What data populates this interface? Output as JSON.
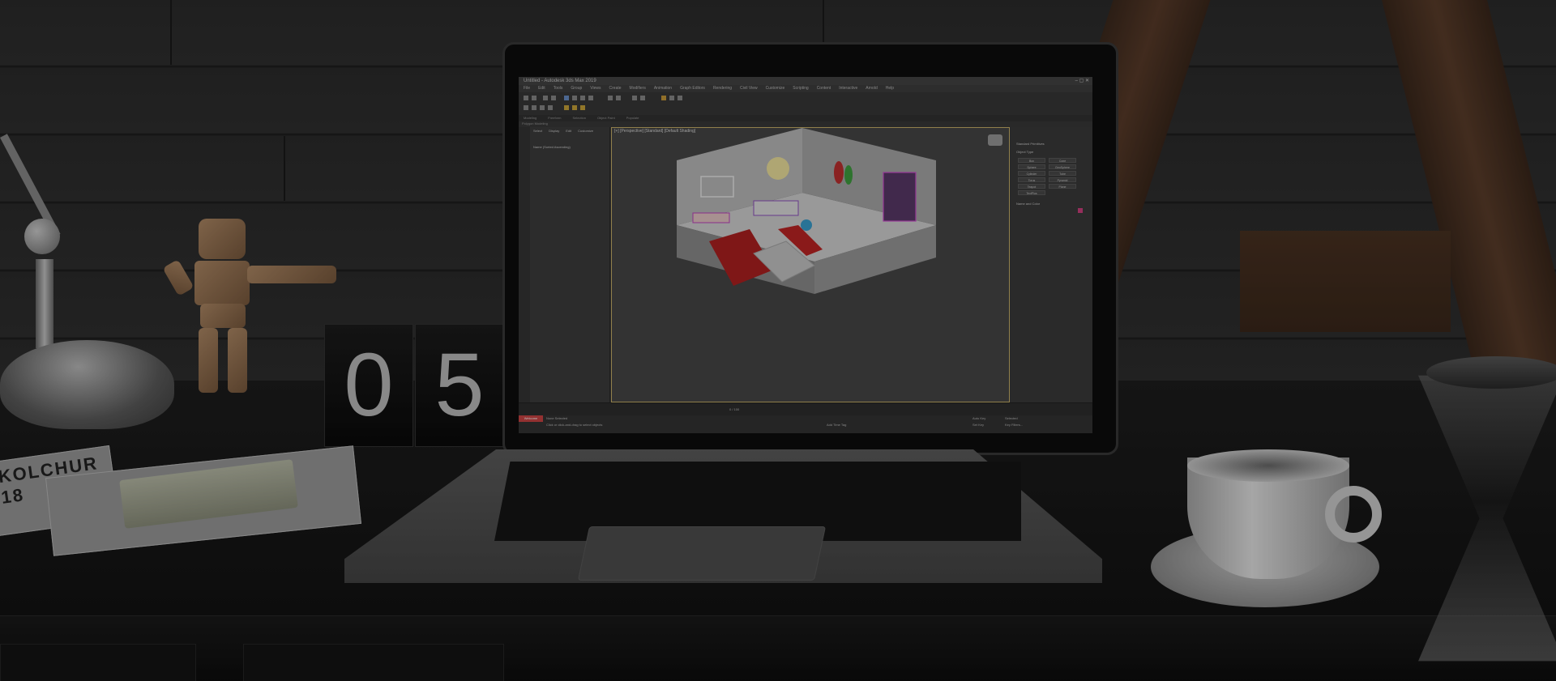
{
  "scene": {
    "flip_clock": {
      "digit_left": "0",
      "digit_right": "5"
    },
    "magazine": {
      "title": "KOLCHUR 18"
    }
  },
  "app": {
    "window_title": "Untitled - Autodesk 3ds Max 2019",
    "window_buttons": "–  ▢  ✕",
    "menu": [
      "File",
      "Edit",
      "Tools",
      "Group",
      "Views",
      "Create",
      "Modifiers",
      "Animation",
      "Graph Editors",
      "Rendering",
      "Civil View",
      "Customize",
      "Scripting",
      "Content",
      "Interactive",
      "Arnold",
      "Help"
    ],
    "ribbon_tabs": [
      "Modeling",
      "Freeform",
      "Selection",
      "Object Paint",
      "Populate"
    ],
    "ribbon_label": "Polygon Modeling",
    "scene_explorer_tabs": [
      "Select",
      "Display",
      "Edit",
      "Customize"
    ],
    "scene_explorer_row": "Name (Sorted Ascending)",
    "viewport_label": "[+] [Perspective] [Standard] [Default Shading]",
    "command_panel": {
      "dropdown": "Standard Primitives",
      "object_type_label": "Object Type",
      "buttons": [
        "Box",
        "Cone",
        "Sphere",
        "GeoSphere",
        "Cylinder",
        "Tube",
        "Torus",
        "Pyramid",
        "Teapot",
        "Plane",
        "TextPlus"
      ],
      "name_color_label": "Name and Color"
    },
    "timeline_text": "0 / 100",
    "status": {
      "welcome_tab": "Welcome",
      "selection": "None Selected",
      "hint": "Click or click-and-drag to select objects",
      "add_time_tag": "Add Time Tag",
      "auto_key": "Auto Key",
      "selected": "Selected",
      "set_key": "Set Key",
      "key_filters": "Key Filters..."
    }
  }
}
